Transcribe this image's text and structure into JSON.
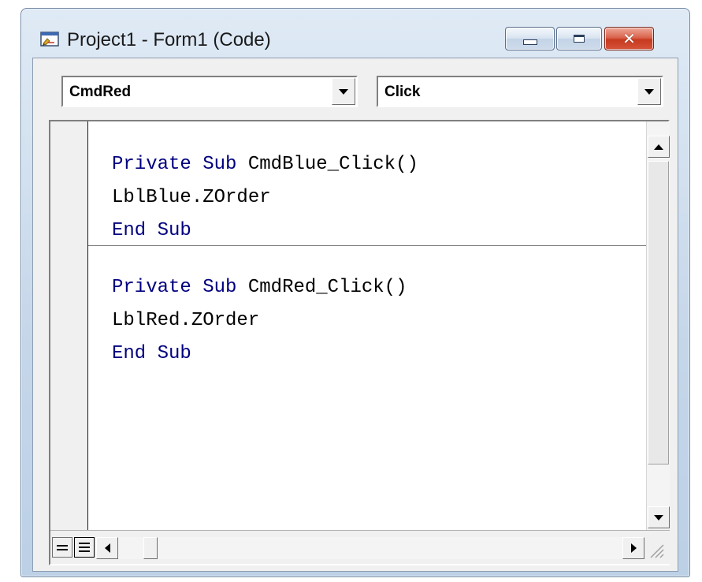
{
  "window": {
    "title": "Project1 - Form1 (Code)",
    "icons": {
      "app": "vb-form-code-icon",
      "minimize": "minimize-icon",
      "maximize": "maximize-icon",
      "close": "close-icon"
    },
    "close_glyph": "✕"
  },
  "toolbar": {
    "object_combo": {
      "value": "CmdRed"
    },
    "procedure_combo": {
      "value": "Click"
    }
  },
  "code": {
    "procedures": [
      {
        "lines": [
          "Private Sub CmdBlue_Click()",
          "LblBlue.ZOrder",
          "End Sub"
        ]
      },
      {
        "lines": [
          "Private Sub CmdRed_Click()",
          "LblRed.ZOrder",
          "End Sub"
        ]
      }
    ],
    "keywords": {
      "private": "Private",
      "sub": "Sub",
      "end": "End"
    }
  },
  "colors": {
    "keyword": "#00007f",
    "text": "#000000",
    "close_button": "#c73a20"
  }
}
